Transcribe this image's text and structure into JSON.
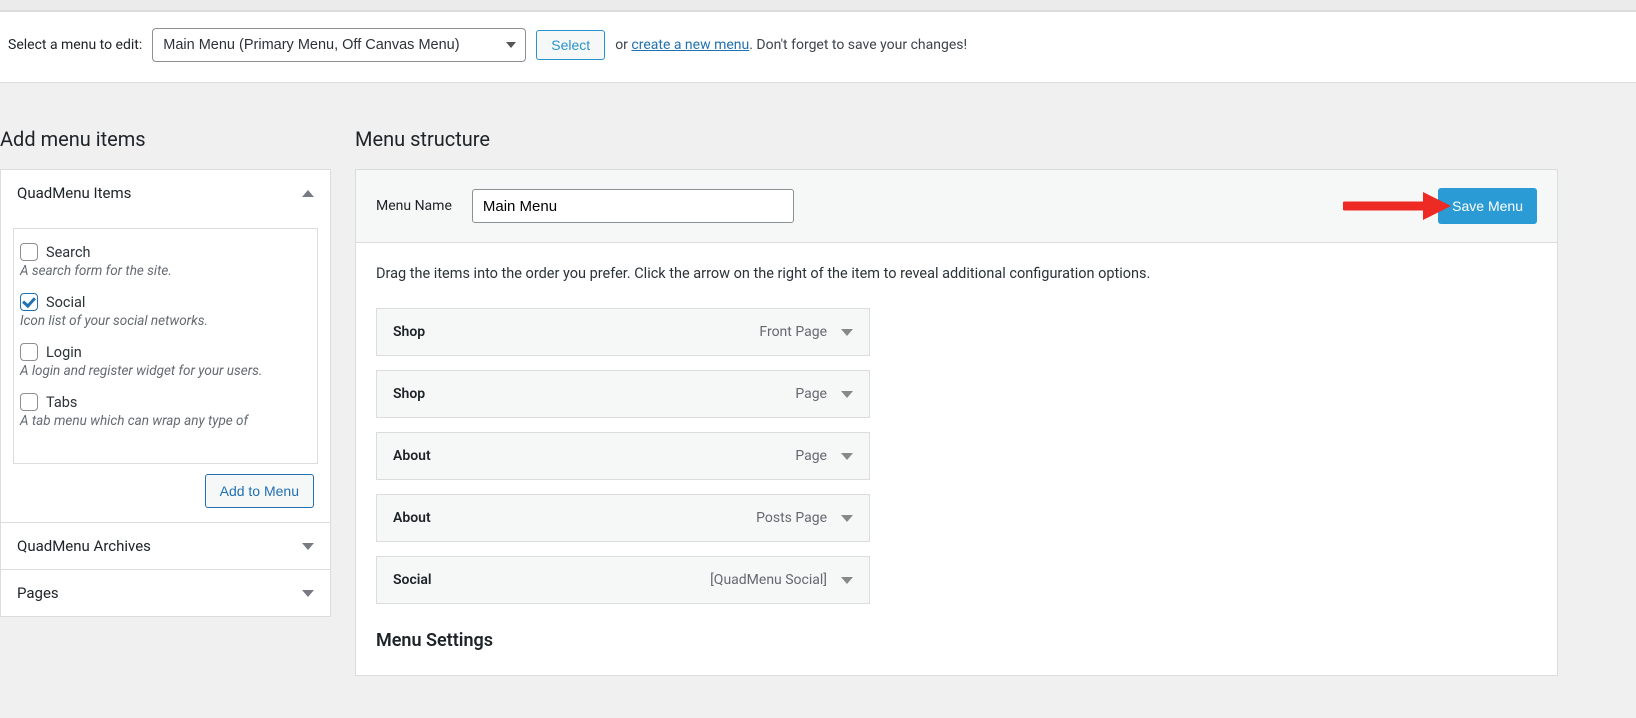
{
  "selectRow": {
    "label": "Select a menu to edit:",
    "selected": "Main Menu (Primary Menu, Off Canvas Menu)",
    "selectBtn": "Select",
    "or": "or ",
    "createLink": "create a new menu",
    "reminder": ". Don't forget to save your changes!"
  },
  "leftCol": {
    "heading": "Add menu items",
    "acc1": {
      "title": "QuadMenu Items",
      "items": [
        {
          "label": "Search",
          "desc": "A search form for the site.",
          "checked": false
        },
        {
          "label": "Social",
          "desc": "Icon list of your social networks.",
          "checked": true
        },
        {
          "label": "Login",
          "desc": "A login and register widget for your users.",
          "checked": false
        },
        {
          "label": "Tabs",
          "desc": "A tab menu which can wrap any type of",
          "checked": false
        }
      ],
      "addBtn": "Add to Menu"
    },
    "acc2": {
      "title": "QuadMenu Archives"
    },
    "acc3": {
      "title": "Pages"
    }
  },
  "rightCol": {
    "heading": "Menu structure",
    "nameLabel": "Menu Name",
    "nameValue": "Main Menu",
    "saveBtn": "Save Menu",
    "hint": "Drag the items into the order you prefer. Click the arrow on the right of the item to reveal additional configuration options.",
    "items": [
      {
        "title": "Shop",
        "type": "Front Page"
      },
      {
        "title": "Shop",
        "type": "Page"
      },
      {
        "title": "About",
        "type": "Page"
      },
      {
        "title": "About",
        "type": "Posts Page"
      },
      {
        "title": "Social",
        "type": "[QuadMenu Social]"
      }
    ],
    "settingsHeading": "Menu Settings"
  }
}
